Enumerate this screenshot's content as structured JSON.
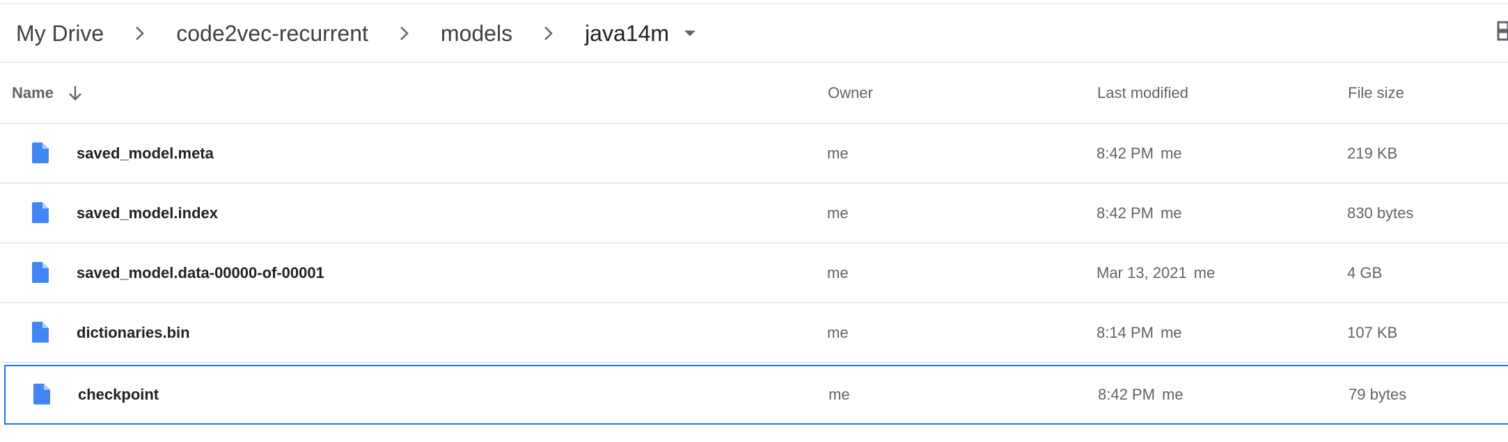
{
  "breadcrumb": {
    "items": [
      "My Drive",
      "code2vec-recurrent",
      "models",
      "java14m"
    ],
    "separator_icon": "chevron-right-icon",
    "dropdown_icon": "arrow-drop-down-icon"
  },
  "view_toggle_icon": "grid-view-icon",
  "table": {
    "headers": {
      "name": "Name",
      "owner": "Owner",
      "last_modified": "Last modified",
      "file_size": "File size"
    },
    "sort_icon": "arrow-downward-icon",
    "rows": [
      {
        "name": "saved_model.meta",
        "owner": "me",
        "modified": "8:42 PM",
        "modified_by": "me",
        "size": "219 KB",
        "icon": "file-icon"
      },
      {
        "name": "saved_model.index",
        "owner": "me",
        "modified": "8:42 PM",
        "modified_by": "me",
        "size": "830 bytes",
        "icon": "file-icon"
      },
      {
        "name": "saved_model.data-00000-of-00001",
        "owner": "me",
        "modified": "Mar 13, 2021",
        "modified_by": "me",
        "size": "4 GB",
        "icon": "file-icon"
      },
      {
        "name": "dictionaries.bin",
        "owner": "me",
        "modified": "8:14 PM",
        "modified_by": "me",
        "size": "107 KB",
        "icon": "file-icon"
      },
      {
        "name": "checkpoint",
        "owner": "me",
        "modified": "8:42 PM",
        "modified_by": "me",
        "size": "79 bytes",
        "icon": "file-icon",
        "selected": true
      }
    ]
  },
  "colors": {
    "file_icon": "#4285f4",
    "selection_border": "#1a73e8",
    "divider": "#dadce0"
  }
}
